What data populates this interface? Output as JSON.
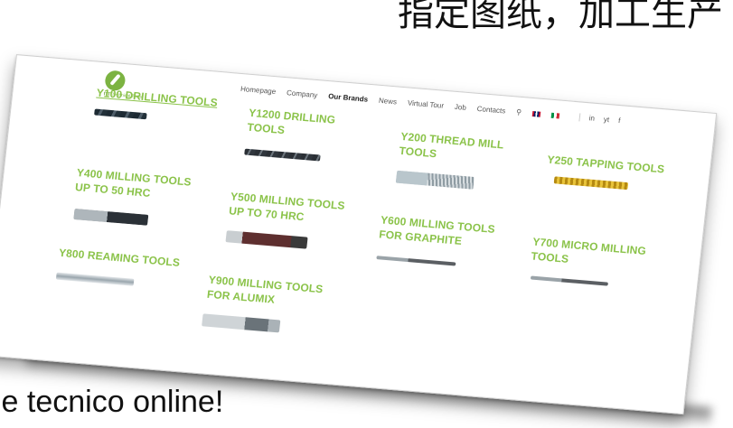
{
  "background_text": {
    "top": "指定图纸，加工生产",
    "bottom": "le tecnico online!"
  },
  "logo": {
    "mark_label": "ITT",
    "tagline": "Technical Tools"
  },
  "nav": {
    "items": [
      "Homepage",
      "Company",
      "Our Brands",
      "News",
      "Virtual Tour",
      "Job",
      "Contacts"
    ],
    "active": "Our Brands",
    "social": [
      "in",
      "yt",
      "f"
    ]
  },
  "products": [
    {
      "title": "Y100 DRILLING TOOLS",
      "icon": "drill-bit-icon"
    },
    {
      "title": "Y1200 DRILLING TOOLS",
      "icon": "drill-bit-icon"
    },
    {
      "title": "Y200 THREAD MILL TOOLS",
      "icon": "thread-mill-icon"
    },
    {
      "title": "Y250 TAPPING TOOLS",
      "icon": "tap-icon"
    },
    {
      "title": "Y400 MILLING TOOLS UP TO 50 HRC",
      "icon": "end-mill-icon"
    },
    {
      "title": "Y500 MILLING TOOLS UP TO 70 HRC",
      "icon": "end-mill-icon"
    },
    {
      "title": "Y600 MILLING TOOLS FOR GRAPHITE",
      "icon": "micro-mill-icon"
    },
    {
      "title": "Y700 MICRO MILLING TOOLS",
      "icon": "micro-mill-icon"
    },
    {
      "title": "Y800 REAMING TOOLS",
      "icon": "reamer-icon"
    },
    {
      "title": "Y900 MILLING TOOLS FOR ALUMIX",
      "icon": "ball-mill-icon"
    }
  ],
  "colors": {
    "accent": "#8bc34a",
    "logo": "#7cb342"
  }
}
